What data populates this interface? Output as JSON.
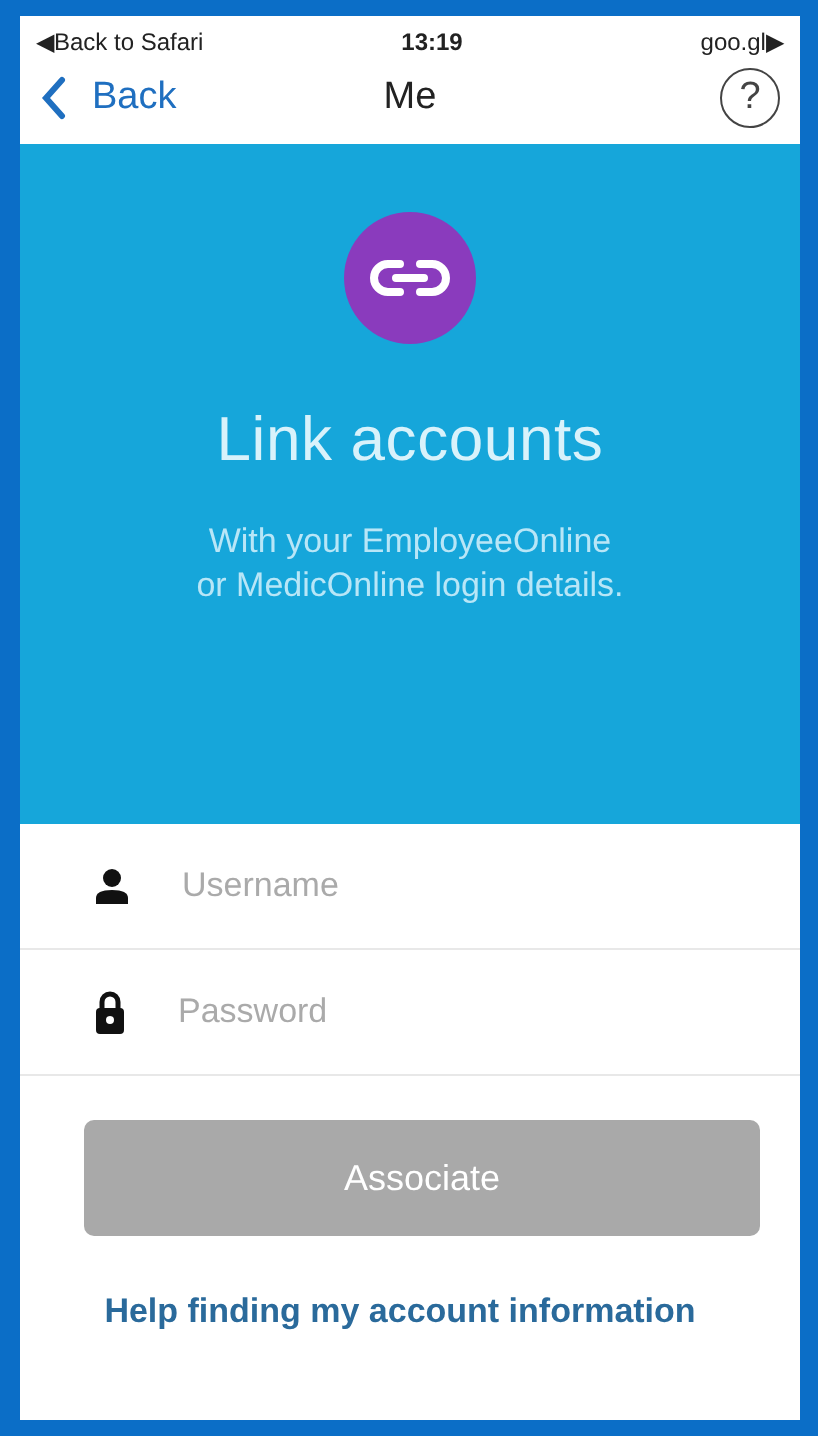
{
  "status_bar": {
    "back_app": "◀Back to Safari",
    "time": "13:19",
    "link": "goo.gl▶"
  },
  "nav_bar": {
    "back": "Back",
    "title": "Me",
    "help": "?"
  },
  "hero": {
    "title": "Link accounts",
    "subtitle": "With your EmployeeOnline or MedicOnline login details."
  },
  "fields": [
    {
      "kind": "username",
      "placeholder": "Username"
    },
    {
      "kind": "password",
      "placeholder": "Password"
    }
  ],
  "button": {
    "label": "Associate",
    "disabled": true
  },
  "help_link": "Help finding my account information"
}
